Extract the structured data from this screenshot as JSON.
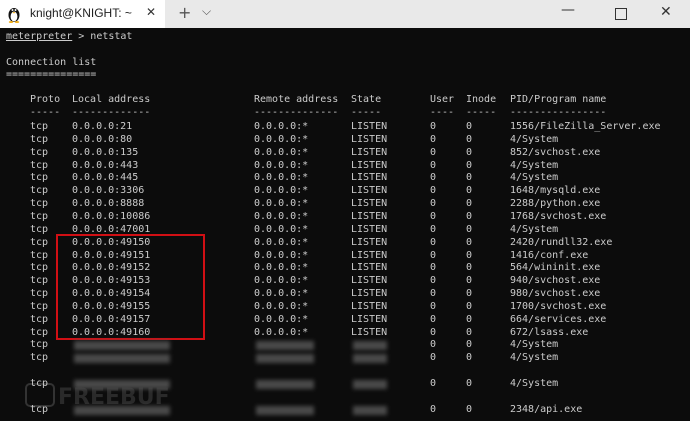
{
  "window": {
    "tab_title": "knight@KNIGHT: ~",
    "close_glyph": "✕",
    "new_tab_glyph": "+",
    "dropdown_glyph": "⌵",
    "minimize_glyph": "—",
    "close_window_glyph": "✕",
    "tab_icon": "linux-penguin-icon"
  },
  "terminal": {
    "prompt": "meterpreter",
    "command": " > netstat",
    "heading": "Connection list",
    "heading_rule": "===============",
    "columns": [
      "Proto",
      "Local address",
      "Remote address",
      "State",
      "User",
      "Inode",
      "PID/Program name"
    ],
    "column_rules": [
      "-----",
      "-------------",
      "--------------",
      "-----",
      "----",
      "-----",
      "----------------"
    ],
    "rows": [
      {
        "proto": "tcp",
        "local": "0.0.0.0:21",
        "remote": "0.0.0.0:*",
        "state": "LISTEN",
        "user": "0",
        "inode": "0",
        "pid": "1556/FileZilla_Server.exe"
      },
      {
        "proto": "tcp",
        "local": "0.0.0.0:80",
        "remote": "0.0.0.0:*",
        "state": "LISTEN",
        "user": "0",
        "inode": "0",
        "pid": "4/System"
      },
      {
        "proto": "tcp",
        "local": "0.0.0.0:135",
        "remote": "0.0.0.0:*",
        "state": "LISTEN",
        "user": "0",
        "inode": "0",
        "pid": "852/svchost.exe"
      },
      {
        "proto": "tcp",
        "local": "0.0.0.0:443",
        "remote": "0.0.0.0:*",
        "state": "LISTEN",
        "user": "0",
        "inode": "0",
        "pid": "4/System"
      },
      {
        "proto": "tcp",
        "local": "0.0.0.0:445",
        "remote": "0.0.0.0:*",
        "state": "LISTEN",
        "user": "0",
        "inode": "0",
        "pid": "4/System"
      },
      {
        "proto": "tcp",
        "local": "0.0.0.0:3306",
        "remote": "0.0.0.0:*",
        "state": "LISTEN",
        "user": "0",
        "inode": "0",
        "pid": "1648/mysqld.exe"
      },
      {
        "proto": "tcp",
        "local": "0.0.0.0:8888",
        "remote": "0.0.0.0:*",
        "state": "LISTEN",
        "user": "0",
        "inode": "0",
        "pid": "2288/python.exe"
      },
      {
        "proto": "tcp",
        "local": "0.0.0.0:10086",
        "remote": "0.0.0.0:*",
        "state": "LISTEN",
        "user": "0",
        "inode": "0",
        "pid": "1768/svchost.exe"
      },
      {
        "proto": "tcp",
        "local": "0.0.0.0:47001",
        "remote": "0.0.0.0:*",
        "state": "LISTEN",
        "user": "0",
        "inode": "0",
        "pid": "4/System"
      },
      {
        "proto": "tcp",
        "local": "0.0.0.0:49150",
        "remote": "0.0.0.0:*",
        "state": "LISTEN",
        "user": "0",
        "inode": "0",
        "pid": "2420/rundll32.exe"
      },
      {
        "proto": "tcp",
        "local": "0.0.0.0:49151",
        "remote": "0.0.0.0:*",
        "state": "LISTEN",
        "user": "0",
        "inode": "0",
        "pid": "1416/conf.exe"
      },
      {
        "proto": "tcp",
        "local": "0.0.0.0:49152",
        "remote": "0.0.0.0:*",
        "state": "LISTEN",
        "user": "0",
        "inode": "0",
        "pid": "564/wininit.exe"
      },
      {
        "proto": "tcp",
        "local": "0.0.0.0:49153",
        "remote": "0.0.0.0:*",
        "state": "LISTEN",
        "user": "0",
        "inode": "0",
        "pid": "940/svchost.exe"
      },
      {
        "proto": "tcp",
        "local": "0.0.0.0:49154",
        "remote": "0.0.0.0:*",
        "state": "LISTEN",
        "user": "0",
        "inode": "0",
        "pid": "980/svchost.exe"
      },
      {
        "proto": "tcp",
        "local": "0.0.0.0:49155",
        "remote": "0.0.0.0:*",
        "state": "LISTEN",
        "user": "0",
        "inode": "0",
        "pid": "1700/svchost.exe"
      },
      {
        "proto": "tcp",
        "local": "0.0.0.0:49157",
        "remote": "0.0.0.0:*",
        "state": "LISTEN",
        "user": "0",
        "inode": "0",
        "pid": "664/services.exe"
      },
      {
        "proto": "tcp",
        "local": "0.0.0.0:49160",
        "remote": "0.0.0.0:*",
        "state": "LISTEN",
        "user": "0",
        "inode": "0",
        "pid": "672/lsass.exe"
      },
      {
        "proto": "tcp",
        "user": "0",
        "inode": "0",
        "pid": "4/System"
      },
      {
        "proto": "tcp",
        "user": "0",
        "inode": "0",
        "pid": "4/System"
      },
      {
        "proto": "tcp",
        "user": "0",
        "inode": "0",
        "pid": "4/System"
      },
      {
        "proto": "tcp",
        "user": "0",
        "inode": "0",
        "pid": "2348/api.exe"
      }
    ]
  },
  "watermark": {
    "text": "FREEBUF",
    "icon": "freebuf-logo-icon"
  },
  "colors": {
    "terminal_bg": "#0c0c0c",
    "terminal_fg": "#cccccc",
    "highlight": "#d10f14",
    "titlebar": "#e9e9e9"
  }
}
